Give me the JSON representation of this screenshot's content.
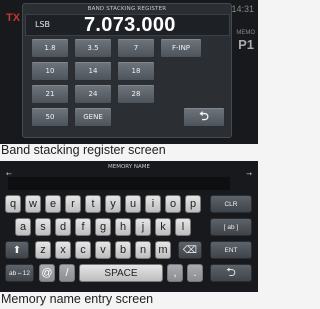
{
  "band_stacking": {
    "tx_indicator": "TX",
    "clock": "14:31",
    "memo_label": "MEMO",
    "memory_channel": "P1",
    "title": "BAND STACKING REGISTER",
    "mode": "LSB",
    "frequency": "7.073.000",
    "buttons": [
      "1.8",
      "3.5",
      "7",
      "F-INP",
      "10",
      "14",
      "18",
      "21",
      "24",
      "28",
      "50",
      "GENE"
    ],
    "return_symbol": "⮌",
    "caption": "Band stacking register screen"
  },
  "memory_name": {
    "title": "MEMORY NAME",
    "left_arrow": "←",
    "right_arrow": "→",
    "row1": [
      "q",
      "w",
      "e",
      "r",
      "t",
      "y",
      "u",
      "i",
      "o",
      "p"
    ],
    "row2": [
      "a",
      "s",
      "d",
      "f",
      "g",
      "h",
      "j",
      "k",
      "l"
    ],
    "row3": [
      "z",
      "x",
      "c",
      "v",
      "b",
      "n",
      "m"
    ],
    "clr": "CLR",
    "ab_toggle": "[ ab ]",
    "shift_symbol": "⬆",
    "del_symbol": "⌫",
    "ent": "ENT",
    "ab12": "ab⇔12",
    "at_key": "@",
    "slash_key": "/",
    "space": "SPACE",
    "comma_key": ",",
    "period_key": ".",
    "return_symbol": "⮌",
    "caption": "Memory name entry screen"
  }
}
